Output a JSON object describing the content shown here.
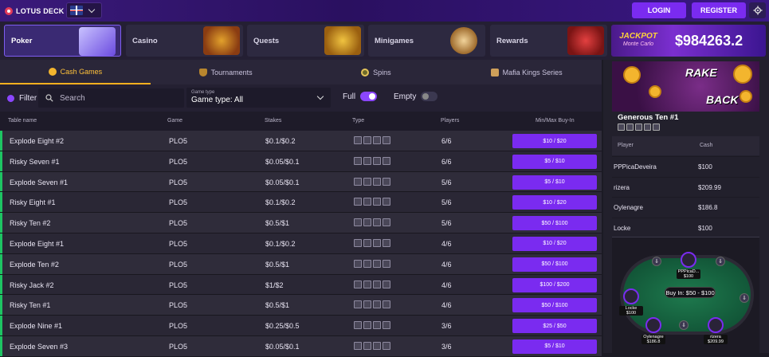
{
  "header": {
    "logo_text": "LOTUS DECK",
    "login_label": "LOGIN",
    "register_label": "REGISTER"
  },
  "nav": [
    {
      "label": "Poker",
      "active": true
    },
    {
      "label": "Casino",
      "active": false
    },
    {
      "label": "Quests",
      "active": false
    },
    {
      "label": "Minigames",
      "active": false
    },
    {
      "label": "Rewards",
      "active": false
    }
  ],
  "jackpot": {
    "label_line1": "JACKPOT",
    "label_line2": "Monte Carlo",
    "amount": "$984263.2"
  },
  "tabs": [
    {
      "label": "Cash Games",
      "active": true
    },
    {
      "label": "Tournaments",
      "active": false
    },
    {
      "label": "Spins",
      "active": false
    },
    {
      "label": "Mafia Kings Series",
      "active": false
    }
  ],
  "filters": {
    "filter_label": "Filter",
    "search_placeholder": "Search",
    "game_type_caption": "Game type",
    "game_type_value": "Game type: All",
    "full_label": "Full",
    "full_on": true,
    "empty_label": "Empty",
    "empty_on": false
  },
  "table": {
    "columns": [
      "Table name",
      "Game",
      "Stakes",
      "Type",
      "Players",
      "Min/Max Buy-In"
    ],
    "rows": [
      {
        "name": "Explode Eight #2",
        "game": "PLO5",
        "stakes": "$0.1/$0.2",
        "players": "6/6",
        "buyin": "$10 / $20"
      },
      {
        "name": "Risky Seven #1",
        "game": "PLO5",
        "stakes": "$0.05/$0.1",
        "players": "6/6",
        "buyin": "$5 / $10"
      },
      {
        "name": "Explode Seven #1",
        "game": "PLO5",
        "stakes": "$0.05/$0.1",
        "players": "5/6",
        "buyin": "$5 / $10"
      },
      {
        "name": "Risky Eight #1",
        "game": "PLO5",
        "stakes": "$0.1/$0.2",
        "players": "5/6",
        "buyin": "$10 / $20"
      },
      {
        "name": "Risky Ten #2",
        "game": "PLO5",
        "stakes": "$0.5/$1",
        "players": "5/6",
        "buyin": "$50 / $100"
      },
      {
        "name": "Explode Eight #1",
        "game": "PLO5",
        "stakes": "$0.1/$0.2",
        "players": "4/6",
        "buyin": "$10 / $20"
      },
      {
        "name": "Explode Ten #2",
        "game": "PLO5",
        "stakes": "$0.5/$1",
        "players": "4/6",
        "buyin": "$50 / $100"
      },
      {
        "name": "Risky Jack #2",
        "game": "PLO5",
        "stakes": "$1/$2",
        "players": "4/6",
        "buyin": "$100 / $200"
      },
      {
        "name": "Risky Ten #1",
        "game": "PLO5",
        "stakes": "$0.5/$1",
        "players": "4/6",
        "buyin": "$50 / $100"
      },
      {
        "name": "Explode Nine #1",
        "game": "PLO5",
        "stakes": "$0.25/$0.5",
        "players": "3/6",
        "buyin": "$25 / $50"
      },
      {
        "name": "Explode Seven #3",
        "game": "PLO5",
        "stakes": "$0.05/$0.1",
        "players": "3/6",
        "buyin": "$5 / $10"
      }
    ]
  },
  "sidebar": {
    "promo_line1": "RAKE",
    "promo_line2": "BACK",
    "table_title": "Generous Ten #1",
    "col_player": "Player",
    "col_cash": "Cash",
    "players": [
      {
        "name": "PPPicaDeveira",
        "cash": "$100"
      },
      {
        "name": "rizera",
        "cash": "$209.99"
      },
      {
        "name": "Oylenagre",
        "cash": "$186.8"
      },
      {
        "name": "Locke",
        "cash": "$100"
      }
    ],
    "buyin_text": "Buy In: $50 - $100",
    "seats": [
      {
        "name": "PPPicaD...",
        "cash": "$100"
      },
      {
        "name": "Locke",
        "cash": "$100"
      },
      {
        "name": "Oylenagre",
        "cash": "$186.8"
      },
      {
        "name": "rizera",
        "cash": "$209.99"
      }
    ]
  },
  "colors": {
    "accent": "#7a2bf0",
    "active_tab": "#ffb01f",
    "row_marker": "#1ec463"
  }
}
